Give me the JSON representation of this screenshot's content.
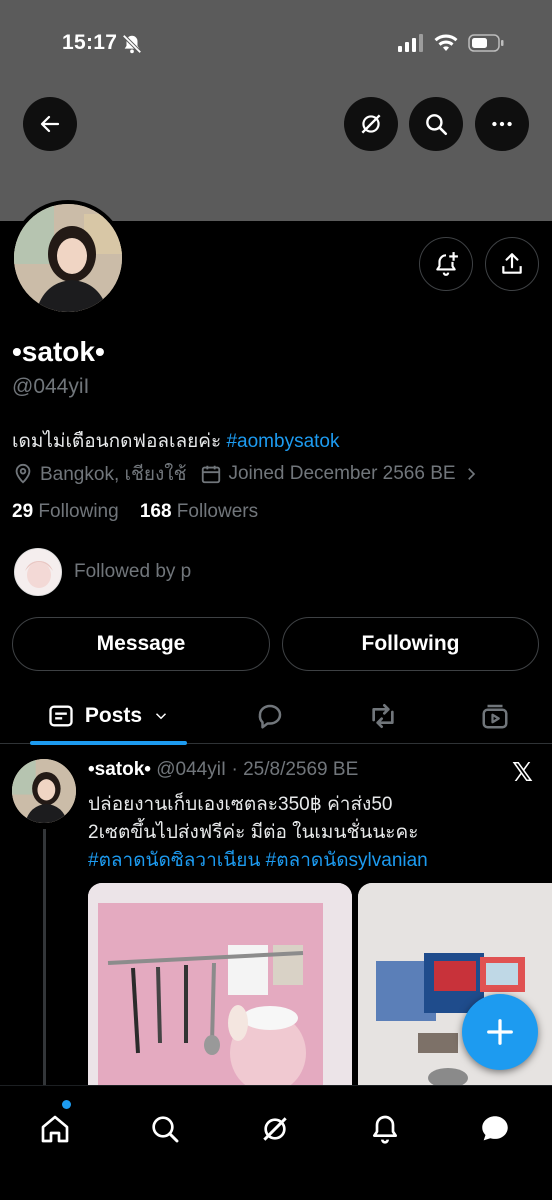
{
  "status_bar": {
    "time": "15:17"
  },
  "profile": {
    "display_name": "•satok•",
    "handle": "@044yiI",
    "bio_text": "เดมไม่เตือนกดฟอลเลยค่ะ ",
    "bio_hashtag": "#aombysatok",
    "location": "Bangkok, เชียงใช้",
    "joined": "Joined December 2566 BE",
    "following_count": "29",
    "following_label": "Following",
    "followers_count": "168",
    "followers_label": "Followers",
    "followed_by": "Followed by p"
  },
  "actions": {
    "message": "Message",
    "following": "Following"
  },
  "tabs": {
    "posts_label": "Posts"
  },
  "post": {
    "name": "•satok•",
    "handle_date": "@044yiI · 25/8/2569 BE",
    "x_glyph": "𝕏",
    "line1": "ปล่อยงานเก็บเองเซตละ350฿ ค่าส่ง50",
    "line2": "2เซตขึ้นไปส่งฟรีค่ะ มีต่อ ในเมนชั่นนะคะ",
    "hashtags": "#ตลาดนัดซิลวาเนียน #ตลาดนัดsylvanian"
  },
  "colors": {
    "accent": "#1d9bf0",
    "banner": "#5b5b5b",
    "muted": "#71767b"
  }
}
